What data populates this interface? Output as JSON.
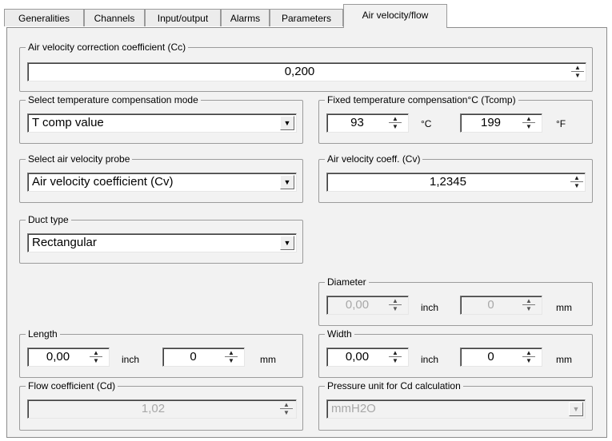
{
  "tabs": [
    {
      "label": "Generalities"
    },
    {
      "label": "Channels"
    },
    {
      "label": "Input/output"
    },
    {
      "label": "Alarms"
    },
    {
      "label": "Parameters"
    },
    {
      "label": "Air velocity/flow",
      "active": true
    }
  ],
  "cc": {
    "title": "Air velocity correction coefficient (Cc)",
    "value": "0,200"
  },
  "temp_mode": {
    "title": "Select temperature compensation mode",
    "value": "T comp value"
  },
  "tcomp": {
    "title": "Fixed temperature compensation°C (Tcomp)",
    "c_value": "93",
    "c_unit": "°C",
    "f_value": "199",
    "f_unit": "°F"
  },
  "probe": {
    "title": "Select air velocity probe",
    "value": "Air velocity coefficient (Cv)"
  },
  "cv": {
    "title": "Air velocity coeff. (Cv)",
    "value": "1,2345"
  },
  "duct": {
    "title": "Duct type",
    "value": "Rectangular"
  },
  "diameter": {
    "title": "Diameter",
    "inch_value": "0,00",
    "inch_unit": "inch",
    "mm_value": "0",
    "mm_unit": "mm"
  },
  "length": {
    "title": "Length",
    "inch_value": "0,00",
    "inch_unit": "inch",
    "mm_value": "0",
    "mm_unit": "mm"
  },
  "width": {
    "title": "Width",
    "inch_value": "0,00",
    "inch_unit": "inch",
    "mm_value": "0",
    "mm_unit": "mm"
  },
  "cd": {
    "title": "Flow coefficient (Cd)",
    "value": "1,02"
  },
  "pressure": {
    "title": "Pressure unit for Cd calculation",
    "value": "mmH2O"
  },
  "icons": {
    "spin_up": "▲",
    "spin_down": "▼",
    "dropdown": "▼"
  }
}
